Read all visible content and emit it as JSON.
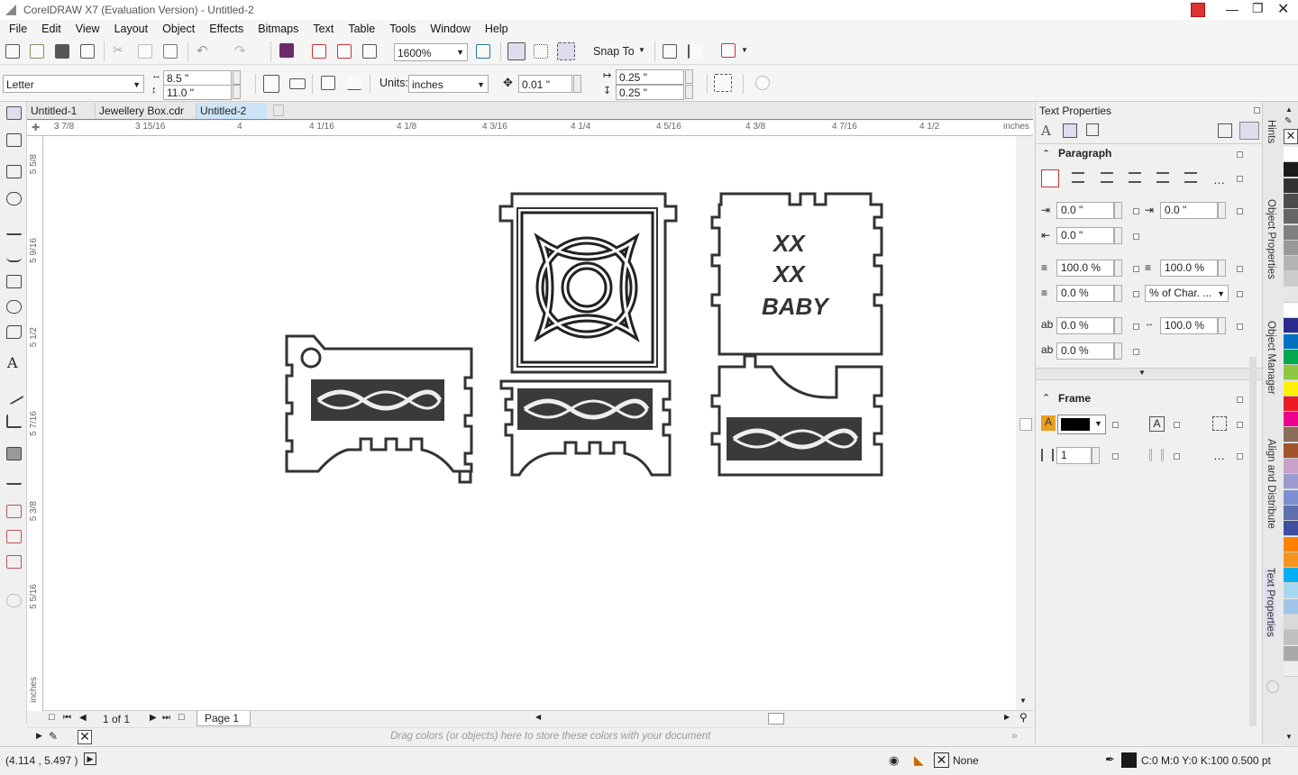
{
  "window": {
    "title": "CorelDRAW X7 (Evaluation Version) - Untitled-2"
  },
  "menu": {
    "items": [
      "File",
      "Edit",
      "View",
      "Layout",
      "Object",
      "Effects",
      "Bitmaps",
      "Text",
      "Table",
      "Tools",
      "Window",
      "Help"
    ]
  },
  "toolbar": {
    "zoom": "1600%",
    "snap_to": "Snap To"
  },
  "property_bar": {
    "page_size": "Letter",
    "width": "8.5 \"",
    "height": "11.0 \"",
    "units_label": "Units:",
    "units": "inches",
    "nudge": "0.01 \"",
    "dup_x": "0.25 \"",
    "dup_y": "0.25 \""
  },
  "doc_tabs": [
    "Untitled-1",
    "Jewellery Box.cdr",
    "Untitled-2"
  ],
  "ruler": {
    "h_labels": [
      "3 7/8",
      "3 15/16",
      "4",
      "4 1/16",
      "4 1/8",
      "4 3/16",
      "4 1/4",
      "4 5/16",
      "4 3/8",
      "4 7/16",
      "4 1/2",
      "inches"
    ],
    "v_labels": [
      "5 5/8",
      "5 9/16",
      "5 1/2",
      "5 7/16",
      "5 3/8",
      "5 5/16",
      "inches"
    ]
  },
  "canvas_text": {
    "line1": "XX",
    "line2": "XX",
    "line3": "BABY"
  },
  "page_nav": {
    "count": "1 of 1",
    "page": "Page 1"
  },
  "doc_palette_hint": "Drag colors (or objects) here to store these colors with your document",
  "status": {
    "coords": "(4.114 , 5.497 )",
    "fill": "None",
    "outline": "C:0 M:0 Y:0 K:100  0.500 pt"
  },
  "docker": {
    "title": "Text Properties",
    "paragraph": {
      "header": "Paragraph",
      "left_indent": "0.0 \"",
      "first_line_indent": "0.0 \"",
      "right_indent": "0.0 \"",
      "line_spacing": "100.0 %",
      "before_para": "100.0 %",
      "after_para": "0.0 %",
      "spacing_unit": "% of Char. ...",
      "char_spacing": "0.0 %",
      "word_spacing": "100.0 %",
      "lang_spacing": "0.0 %"
    },
    "frame": {
      "header": "Frame",
      "columns": "1"
    }
  },
  "docker_tabs": [
    "Hints",
    "Object Properties",
    "Object Manager",
    "Align and Distribute",
    "Text Properties"
  ],
  "palette": {
    "colors": [
      "#ffffff",
      "#1a1a1a",
      "#333333",
      "#4d4d4d",
      "#666666",
      "#808080",
      "#999999",
      "#b3b3b3",
      "#cccccc",
      "#e6e6e6",
      "#ffffff",
      "#2a2a8f",
      "#0070c0",
      "#00a84f",
      "#8dc63f",
      "#fff200",
      "#ed1c24",
      "#ec008c",
      "#8b6c58",
      "#a0522d",
      "#c8a2c8",
      "#9b9bd0",
      "#7b8fd0",
      "#5f6fb0",
      "#3f4fa0",
      "#ff8000",
      "#f7941d",
      "#00b0f0",
      "#a3d8f0",
      "#9fc5e8",
      "#d9d9d9",
      "#c0c0c0",
      "#a9a9a9",
      "#eeeeee"
    ]
  }
}
